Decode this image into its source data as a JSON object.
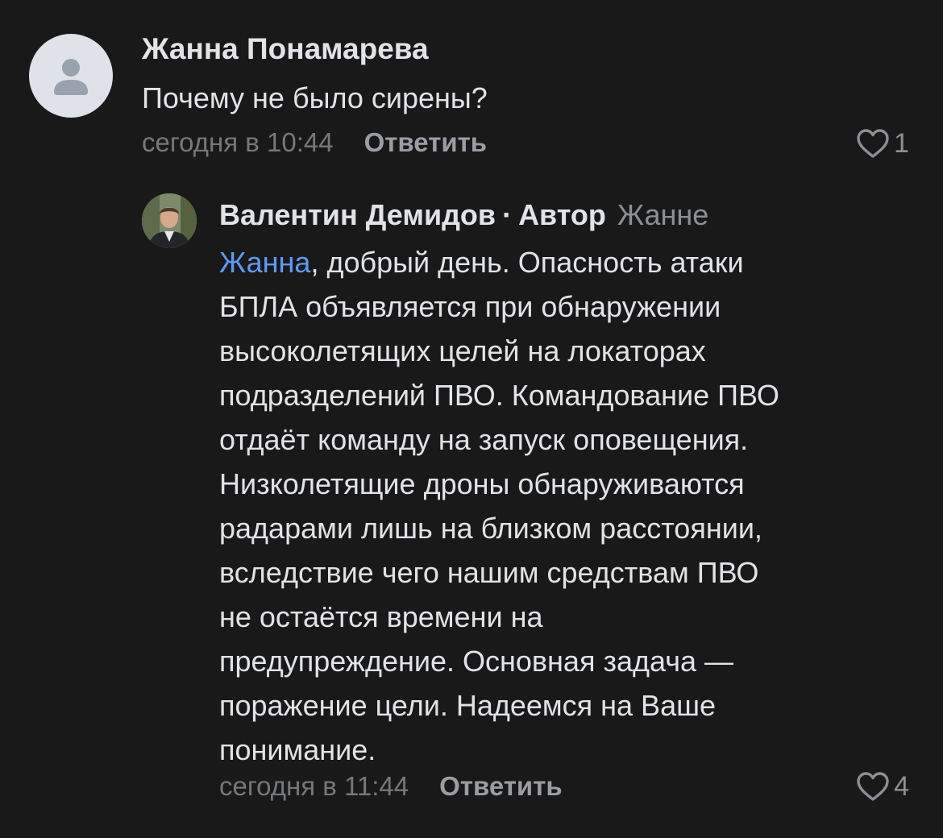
{
  "comments": [
    {
      "author": "Жанна Понамарева",
      "avatar_icon": "user-placeholder-icon",
      "text": "Почему не было сирены?",
      "time": "сегодня в 10:44",
      "reply_label": "Ответить",
      "likes": "1"
    },
    {
      "author": "Валентин Демидов",
      "separator": "·",
      "badge": "Автор",
      "reply_to": "Жанне",
      "mention": "Жанна",
      "text_lines": [
        ", добрый день. Опасность атаки",
        "БПЛА объявляется при обнаружении",
        "высоколетящих целей на локаторах",
        "подразделений ПВО. Командование ПВО",
        "отдаёт команду на запуск оповещения.",
        "Низколетящие дроны обнаруживаются",
        "радарами лишь на близком расстоянии,",
        "вследствие чего нашим средствам ПВО",
        "не остаётся времени на",
        "предупреждение. Основная задача —",
        "поражение цели. Надеемся на Ваше",
        "понимание."
      ],
      "time": "сегодня в 11:44",
      "reply_label": "Ответить",
      "likes": "4"
    }
  ],
  "colors": {
    "background": "#19191a",
    "text": "#e1e3e6",
    "secondary": "#76787a",
    "mention": "#5a9cf2"
  }
}
